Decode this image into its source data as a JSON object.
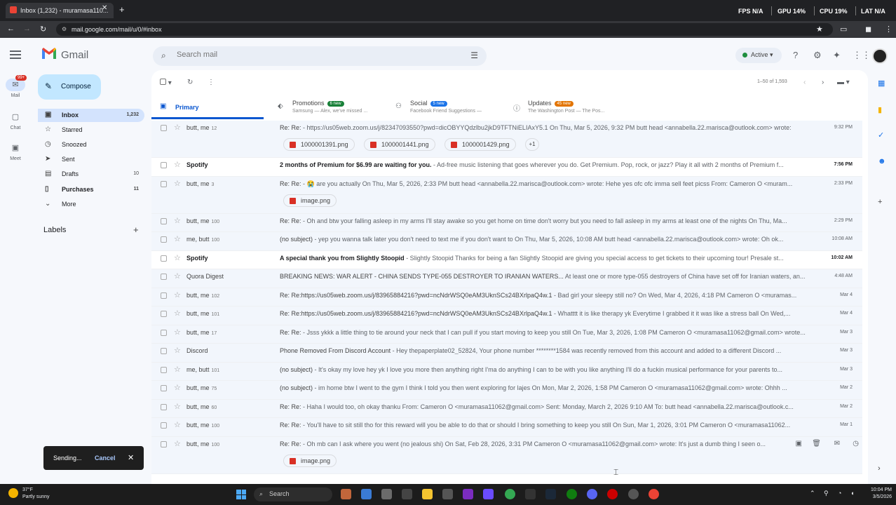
{
  "browser": {
    "tab_title": "Inbox (1,232) - muramasa110...",
    "url": "mail.google.com/mail/u/0/#inbox",
    "perf": [
      "FPS N/A",
      "GPU 14%",
      "CPU 19%",
      "LAT N/A"
    ]
  },
  "header": {
    "logo_text": "Gmail",
    "search_placeholder": "Search mail",
    "status": "Active"
  },
  "rail": [
    {
      "label": "Mail",
      "badge": "99+"
    },
    {
      "label": "Chat"
    },
    {
      "label": "Meet"
    }
  ],
  "sidebar": {
    "compose": "Compose",
    "items": [
      {
        "label": "Inbox",
        "count": "1,232"
      },
      {
        "label": "Starred",
        "count": ""
      },
      {
        "label": "Snoozed",
        "count": ""
      },
      {
        "label": "Sent",
        "count": ""
      },
      {
        "label": "Drafts",
        "count": "10"
      },
      {
        "label": "Purchases",
        "count": "11"
      },
      {
        "label": "More",
        "count": ""
      }
    ],
    "labels_title": "Labels"
  },
  "toolbar": {
    "pager": "1–50 of 1,593"
  },
  "category_tabs": [
    {
      "label": "Primary"
    },
    {
      "label": "Promotions",
      "badge": "6 new",
      "sub": "Samsung — Alex, we've missed ..."
    },
    {
      "label": "Social",
      "badge": "5 new",
      "sub": "Facebook Friend Suggestions —"
    },
    {
      "label": "Updates",
      "badge": "45 new",
      "sub": "The Washington Post — The Pos..."
    }
  ],
  "emails": [
    {
      "sender": "butt, me",
      "count": "12",
      "subject": "Re: Re:",
      "snippet": " - https://us05web.zoom.us/j/82347093550?pwd=dicOBYYQdzlbu2jkD9TFTNiELIAxY5.1 On Thu, Mar 5, 2026, 9:32 PM butt head <annabella.22.marisca@outlook.com> wrote:",
      "date": "9:32 PM",
      "attachments": [
        "1000001391.png",
        "1000001441.png",
        "1000001429.png"
      ],
      "more": "+1"
    },
    {
      "sender": "Spotify",
      "count": "",
      "subject": "2 months of Premium for $6.99 are waiting for you.",
      "snippet": " - Ad-free music listening that goes wherever you do. Get Premium. Pop, rock, or jazz? Play it all with 2 months of Premium f...",
      "date": "7:56 PM",
      "unread": true
    },
    {
      "sender": "butt, me",
      "count": "3",
      "subject": "Re: Re:",
      "snippet": " - 😭 are you actually On Thu, Mar 5, 2026, 2:33 PM butt head <annabella.22.marisca@outlook.com> wrote: Hehe yes ofc ofc imma sell feet picss From: Cameron O <muram...",
      "date": "2:33 PM",
      "attachments": [
        "image.png"
      ]
    },
    {
      "sender": "butt, me",
      "count": "100",
      "subject": "Re: Re:",
      "snippet": " - Oh and btw your falling asleep in my arms I'll stay awake so you get home on time don't worry but you need to fall asleep in my arms at least one of the nights On Thu, Ma...",
      "date": "2:29 PM"
    },
    {
      "sender": "me, butt",
      "count": "100",
      "subject": "(no subject)",
      "snippet": " - yep you wanna talk later you don't need to text me if you don't want to On Thu, Mar 5, 2026, 10:08 AM butt head <annabella.22.marisca@outlook.com> wrote: Oh ok...",
      "date": "10:08 AM"
    },
    {
      "sender": "Spotify",
      "count": "",
      "subject": "A special thank you from Slightly Stoopid",
      "snippet": " - Slightly Stoopid Thanks for being a fan Slightly Stoopid are giving you special access to get tickets to their upcoming tour! Presale st...",
      "date": "10:02 AM",
      "unread": true
    },
    {
      "sender": "Quora Digest",
      "count": "",
      "subject": "BREAKING NEWS: WAR ALERT - CHINA SENDS TYPE-055 DESTROYER TO IRANIAN WATERS...",
      "snippet": " At least one or more type-055 destroyers of China have set off for Iranian waters, an...",
      "date": "4:48 AM"
    },
    {
      "sender": "butt, me",
      "count": "102",
      "subject": "Re: Re:https://us05web.zoom.us/j/83965884216?pwd=ncNdrWSQ0eAM3UknSCs24BXrlpaQ4w.1",
      "snippet": " - Bad girl your sleepy still no? On Wed, Mar 4, 2026, 4:18 PM Cameron O <muramas...",
      "date": "Mar 4"
    },
    {
      "sender": "butt, me",
      "count": "101",
      "subject": "Re: Re:https://us05web.zoom.us/j/83965884216?pwd=ncNdrWSQ0eAM3UknSCs24BXrlpaQ4w.1",
      "snippet": " - Whatttt it is like therapy yk Everytime I grabbed it it was like a stress ball On Wed,...",
      "date": "Mar 4"
    },
    {
      "sender": "butt, me",
      "count": "17",
      "subject": "Re: Re:",
      "snippet": " - Jsss ykkk a little thing to tie around your neck that I can pull if you start moving to keep you still On Tue, Mar 3, 2026, 1:08 PM Cameron O <muramasa11062@gmail.com> wrote...",
      "date": "Mar 3"
    },
    {
      "sender": "Discord",
      "count": "",
      "subject": "Phone Removed From Discord Account",
      "snippet": " - Hey thepaperplate02_52824, Your phone number ********1584 was recently removed from this account and added to a different Discord ...",
      "date": "Mar 3"
    },
    {
      "sender": "me, butt",
      "count": "101",
      "subject": "(no subject)",
      "snippet": " - It's okay my love hey yk I love you more then anything right I'ma do anything I can to be with you like anything I'll do a fuckin musical performance for your parents to...",
      "date": "Mar 3"
    },
    {
      "sender": "butt, me",
      "count": "75",
      "subject": "(no subject)",
      "snippet": " - im home btw I went to the gym I think I told you then went exploring for lajes On Mon, Mar 2, 2026, 1:58 PM Cameron O <muramasa11062@gmail.com> wrote: Ohhh ...",
      "date": "Mar 2"
    },
    {
      "sender": "butt, me",
      "count": "60",
      "subject": "Re: Re:",
      "snippet": " - Haha I would too, oh okay thanku From: Cameron O <muramasa11062@gmail.com> Sent: Monday, March 2, 2026 9:10 AM To: butt head <annabella.22.marisca@outlook.c...",
      "date": "Mar 2"
    },
    {
      "sender": "butt, me",
      "count": "100",
      "subject": "Re: Re:",
      "snippet": " - You'll have to sit still tho for this reward will you be able to do that or should I bring something to keep you still On Sun, Mar 1, 2026, 3:01 PM Cameron O <muramasa11062...",
      "date": "Mar 1"
    },
    {
      "sender": "butt, me",
      "count": "100",
      "subject": "Re: Re:",
      "snippet": " - Oh mb can I ask where you went (no jealous shi) On Sat, Feb 28, 2026, 3:31 PM Cameron O <muramasa11062@gmail.com> wrote: It's just a dumb thing I seen o...",
      "date": "",
      "attachments": [
        "image.png"
      ],
      "hover": true
    }
  ],
  "snackbar": {
    "message": "Sending...",
    "action": "Cancel"
  },
  "taskbar": {
    "weather_temp": "37°F",
    "weather_desc": "Partly sunny",
    "search": "Search",
    "time": "10:04 PM",
    "date": "3/5/2026"
  },
  "colors": {
    "primary": "#0b57d0",
    "compose": "#c2e7ff",
    "promo_badge": "#188038",
    "social_badge": "#1a73e8",
    "updates_badge": "#e37400"
  }
}
